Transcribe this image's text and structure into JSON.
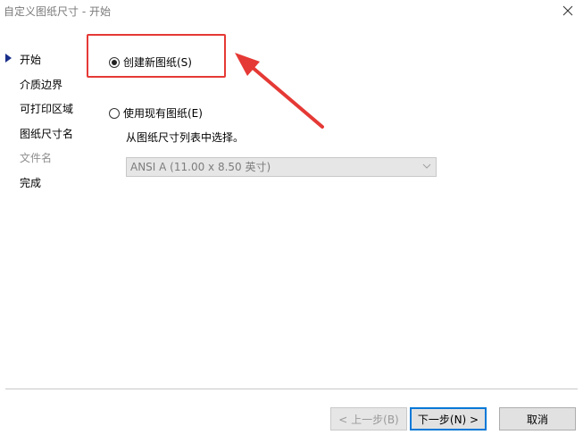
{
  "window": {
    "title": "自定义图纸尺寸 - 开始"
  },
  "sidebar": {
    "items": [
      {
        "label": "开始",
        "active": true,
        "enabled": true
      },
      {
        "label": "介质边界",
        "enabled": true
      },
      {
        "label": "可打印区域",
        "enabled": true
      },
      {
        "label": "图纸尺寸名",
        "enabled": true
      },
      {
        "label": "文件名",
        "enabled": false
      },
      {
        "label": "完成",
        "enabled": true
      }
    ]
  },
  "options": {
    "create_new": {
      "label": "创建新图纸(S)",
      "checked": true
    },
    "use_existing": {
      "label": "使用现有图纸(E)",
      "checked": false
    },
    "hint": "从图纸尺寸列表中选择。",
    "size_select": {
      "value": "ANSI A (11.00 x 8.50 英寸)",
      "enabled": false
    }
  },
  "buttons": {
    "back": "< 上一步(B)",
    "next": "下一步(N) >",
    "cancel": "取消"
  },
  "annotation": {
    "color": "#e53935"
  }
}
